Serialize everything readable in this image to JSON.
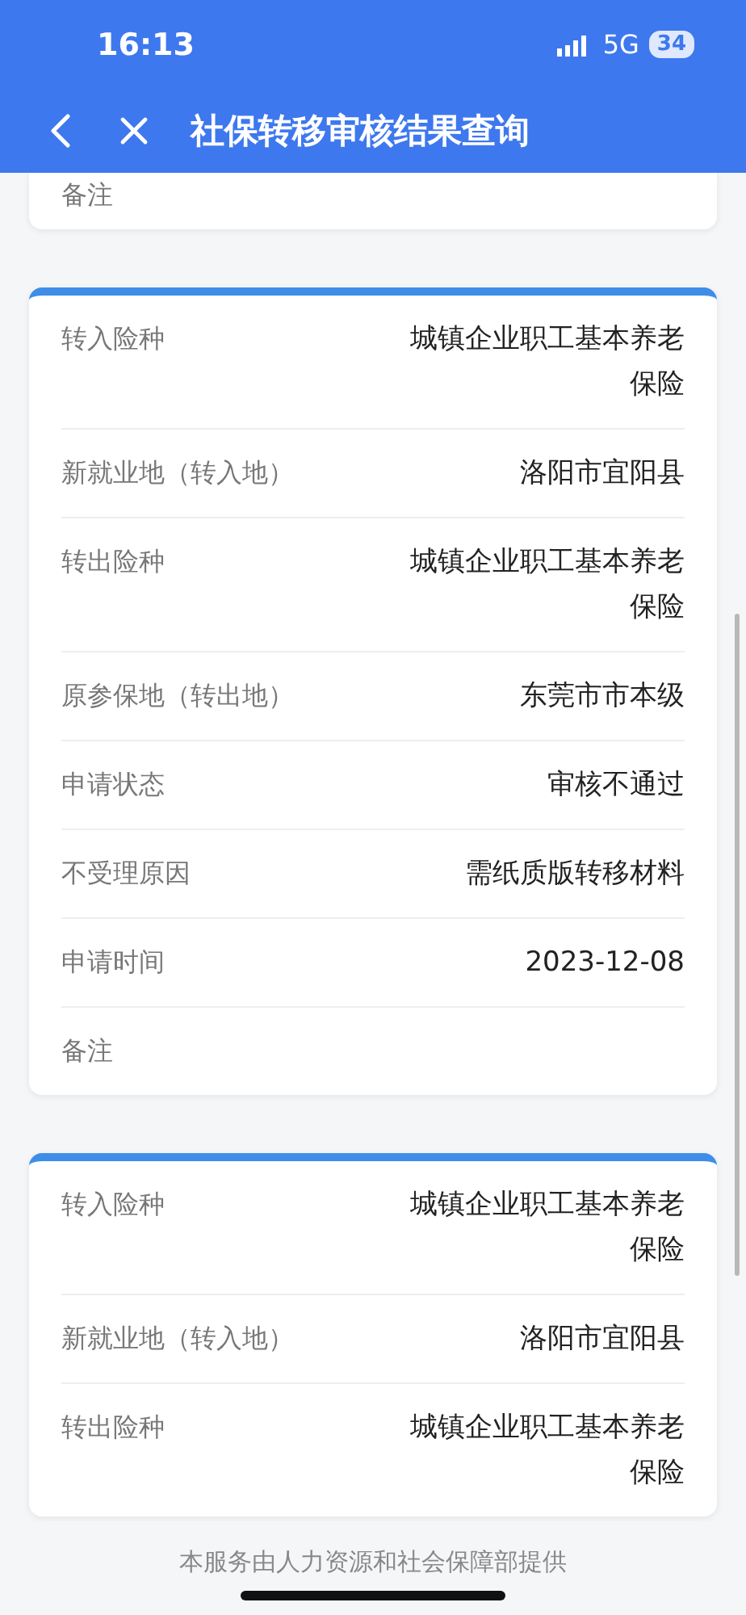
{
  "status_bar": {
    "time": "16:13",
    "network": "5G",
    "battery": "34"
  },
  "header": {
    "title": "社保转移审核结果查询"
  },
  "cards": [
    {
      "cut_top": true,
      "rows": [
        {
          "label": "备注"
        }
      ]
    },
    {
      "cut_top": false,
      "rows": [
        {
          "label": "转入险种",
          "value": "城镇企业职工基本养老保险"
        },
        {
          "label": "新就业地（转入地）",
          "value": "洛阳市宜阳县"
        },
        {
          "label": "转出险种",
          "value": "城镇企业职工基本养老保险"
        },
        {
          "label": "原参保地（转出地）",
          "value": "东莞市市本级"
        },
        {
          "label": "申请状态",
          "value": "审核不通过"
        },
        {
          "label": "不受理原因",
          "value": "需纸质版转移材料"
        },
        {
          "label": "申请时间",
          "value": "2023-12-08"
        },
        {
          "label": "备注"
        }
      ]
    },
    {
      "cut_top": false,
      "rows": [
        {
          "label": "转入险种",
          "value": "城镇企业职工基本养老保险"
        },
        {
          "label": "新就业地（转入地）",
          "value": "洛阳市宜阳县"
        },
        {
          "label": "转出险种",
          "value": "城镇企业职工基本养老保险"
        }
      ]
    }
  ],
  "footer": {
    "text": "本服务由人力资源和社会保障部提供"
  }
}
